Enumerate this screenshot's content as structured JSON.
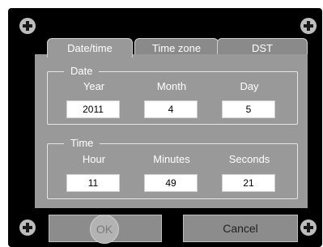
{
  "tabs": [
    {
      "label": "Date/time",
      "selected": true
    },
    {
      "label": "Time zone",
      "selected": false
    },
    {
      "label": "DST",
      "selected": false
    }
  ],
  "date_group": {
    "legend": "Date",
    "year_label": "Year",
    "month_label": "Month",
    "day_label": "Day",
    "year_value": "2011",
    "month_value": "4",
    "day_value": "5"
  },
  "time_group": {
    "legend": "Time",
    "hour_label": "Hour",
    "minutes_label": "Minutes",
    "seconds_label": "Seconds",
    "hour_value": "11",
    "minutes_value": "49",
    "seconds_value": "21"
  },
  "buttons": {
    "ok_label": "OK",
    "cancel_label": "Cancel"
  },
  "colors": {
    "frame": "#000000",
    "panel": "#999999",
    "corner_button": "#bdbdbd"
  },
  "icons": {
    "corner": "plus-circle-icon"
  }
}
